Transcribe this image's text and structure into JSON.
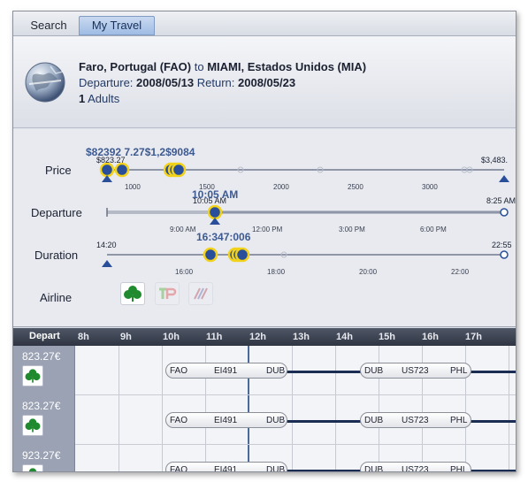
{
  "tabs": [
    {
      "label": "Search",
      "active": false
    },
    {
      "label": "My Travel",
      "active": true
    }
  ],
  "header": {
    "origin": "Faro, Portugal (FAO)",
    "to_word": "to",
    "destination": "MIAMI, Estados Unidos (MIA)",
    "departure_label": "Departure:",
    "departure_date": "2008/05/13",
    "return_label": "Return:",
    "return_date": "2008/05/23",
    "adults_count": "1",
    "adults_label": "Adults"
  },
  "filters": {
    "price": {
      "label": "Price",
      "min_label": "$823.27",
      "max_label": "$3,483.",
      "overlap_label": "$82392 7.27$1,2$9084",
      "ticks": [
        "1000",
        "1500",
        "2000",
        "2500",
        "3000"
      ]
    },
    "departure": {
      "label": "Departure",
      "min_label": "10:05 AM",
      "max_label": "8:25 AM",
      "overlap_label": "10:05 AM",
      "ticks": [
        "9:00 AM",
        "12:00 PM",
        "3:00 PM",
        "6:00 PM"
      ]
    },
    "duration": {
      "label": "Duration",
      "min_label": "14:20",
      "max_label": "22:55",
      "overlap_label": "16:347:006",
      "ticks": [
        "16:00",
        "18:00",
        "20:00",
        "22:00"
      ]
    },
    "airline": {
      "label": "Airline",
      "icons": [
        "shamrock-icon",
        "tap-logo-icon",
        "stripes-logo-icon"
      ]
    }
  },
  "grid": {
    "depart_label": "Depart",
    "hours": [
      "8h",
      "9h",
      "10h",
      "11h",
      "12h",
      "13h",
      "14h",
      "15h",
      "16h",
      "17h"
    ],
    "rows": [
      {
        "price": "823.27€",
        "seg1": {
          "from": "FAO",
          "flight": "EI491",
          "to": "DUB"
        },
        "seg2": {
          "from": "DUB",
          "flight": "US723",
          "to": "PHL"
        }
      },
      {
        "price": "823.27€",
        "seg1": {
          "from": "FAO",
          "flight": "EI491",
          "to": "DUB"
        },
        "seg2": {
          "from": "DUB",
          "flight": "US723",
          "to": "PHL"
        }
      },
      {
        "price": "923.27€",
        "seg1": {
          "from": "FAO",
          "flight": "EI491",
          "to": "DUB"
        },
        "seg2": {
          "from": "DUB",
          "flight": "US723",
          "to": "PHL"
        }
      }
    ]
  },
  "colors": {
    "slider_track": "#8e96a8",
    "knob_yellow": "#f2d21a",
    "knob_blue": "#2a4f9a",
    "accent": "#1c2d54"
  }
}
